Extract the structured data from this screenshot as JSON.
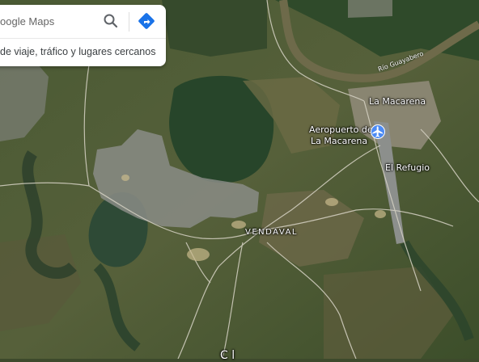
{
  "search": {
    "placeholder": "oogle Maps",
    "hint": "de viaje, tráfico y lugares cercanos"
  },
  "icons": {
    "search": "search-icon",
    "directions": "directions-icon",
    "airport": "airport-icon"
  },
  "places": {
    "la_macarena": "La Macarena",
    "airport_line1": "Aeropuerto de",
    "airport_line2": "La Macarena",
    "el_refugio": "El Refugio",
    "vendaval": "VENDAVAL",
    "river": "Río Guayabero",
    "bottom_partial": "C  l"
  },
  "colors": {
    "accent": "#1a73e8",
    "river": "#6e6a4a"
  }
}
